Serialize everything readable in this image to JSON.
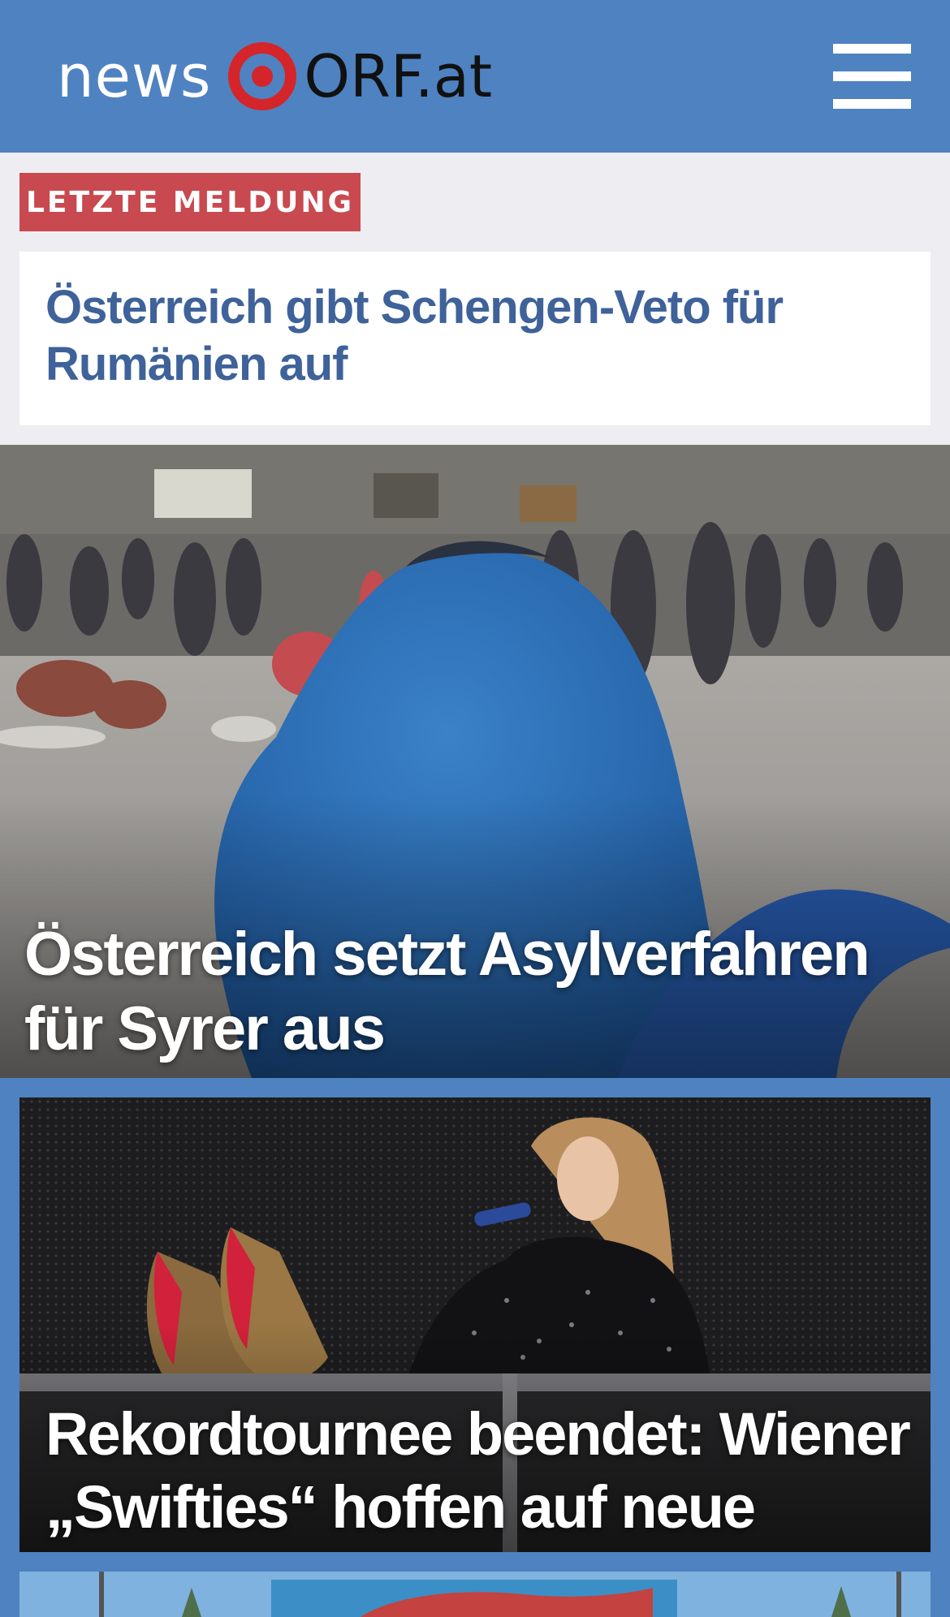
{
  "header": {
    "logo": {
      "news": "news",
      "orf": "ORF.at"
    },
    "menu_icon": "hamburger-menu-icon",
    "bg_color": "#4f82c1"
  },
  "breaking": {
    "badge": "LETZTE MELDUNG",
    "badge_color": "#c8494f",
    "headline": "Österreich gibt Schengen-Veto für Rumänien auf",
    "headline_color": "#3e6299"
  },
  "stories": [
    {
      "headline": "Österreich setzt Asylverfahren für Syrer aus"
    },
    {
      "headline": "Rekordtournee beendet: Wiener „Swifties“ hoffen auf neue Chance"
    }
  ]
}
